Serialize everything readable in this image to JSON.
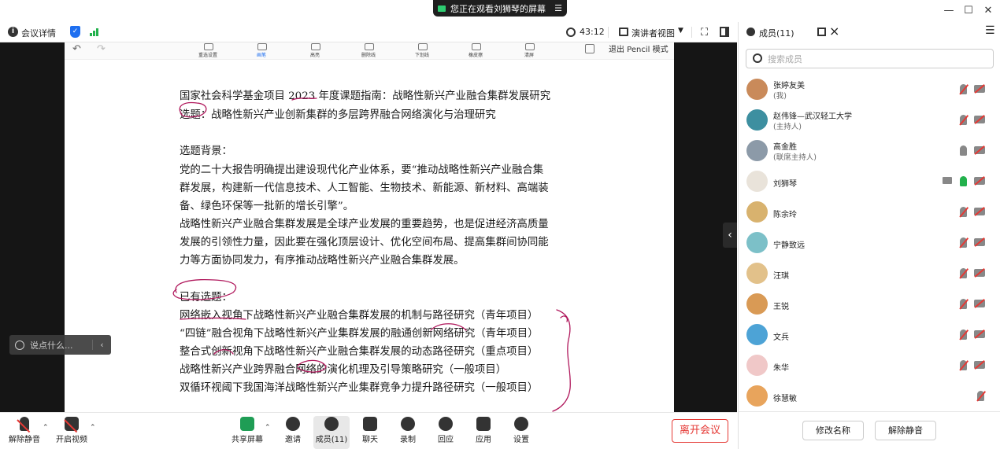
{
  "window": {
    "share_notice": "您正在观看刘狮琴的屏幕",
    "notice_menu": "☰",
    "min": "—",
    "max": "☐",
    "close": "✕"
  },
  "meetbar": {
    "info_label": "会议详情",
    "timer": "43:12",
    "view_label": "演讲者视图"
  },
  "pencil": {
    "tools": [
      "重选设置",
      "画笔",
      "高亮",
      "删除线",
      "下划线",
      "橡皮擦",
      "清屏"
    ],
    "active_tool": "画笔",
    "exit_label": "退出 Pencil 模式"
  },
  "document": {
    "lines": [
      "国家社会科学基金项目 2023 年度课题指南：战略性新兴产业融合集群发展研究",
      "选题：战略性新兴产业创新集群的多层跨界融合网络演化与治理研究",
      "",
      "选题背景：",
      "党的二十大报告明确提出建设现代化产业体系，要“推动战略性新兴产业融合集",
      "群发展，构建新一代信息技术、人工智能、生物技术、新能源、新材料、高端装",
      "备、绿色环保等一批新的增长引擎”。",
      "战略性新兴产业融合集群发展是全球产业发展的重要趋势，也是促进经济高质量",
      "发展的引领性力量，因此要在强化顶层设计、优化空间布局、提高集群间协同能",
      "力等方面协同发力，有序推动战略性新兴产业融合集群发展。",
      "",
      "已有选题：",
      "网络嵌入视角下战略性新兴产业融合集群发展的机制与路径研究（青年项目）",
      "“四链”融合视角下战略性新兴产业集群发展的融通创新网络研究（青年项目）",
      "整合式创新视角下战略性新兴产业融合集群发展的动态路径研究（重点项目）",
      "战略性新兴产业跨界融合网络的演化机理及引导策略研究（一般项目）",
      "双循环视阈下我国海洋战略性新兴产业集群竞争力提升路径研究（一般项目）"
    ]
  },
  "chat": {
    "placeholder": "说点什么..."
  },
  "controls": {
    "unmute": "解除静音",
    "start_video": "开启视频",
    "share_screen": "共享屏幕",
    "invite": "邀请",
    "members": "成员(11)",
    "chat": "聊天",
    "record": "录制",
    "reactions": "回应",
    "apps": "应用",
    "settings": "设置",
    "leave": "离开会议"
  },
  "panel": {
    "title": "成员(11)",
    "search_placeholder": "搜索成员",
    "members": [
      {
        "name": "张婷友美",
        "role": "(我)",
        "avatar": "#c98a5a"
      },
      {
        "name": "赵伟锋—武汉轻工大学",
        "role": "(主持人)",
        "avatar": "#3d8fa0"
      },
      {
        "name": "高金胜",
        "role": "(联席主持人)",
        "avatar": "#8c9aa8"
      },
      {
        "name": "刘狮琴",
        "role": "",
        "avatar": "#e9e3da"
      },
      {
        "name": "陈余玲",
        "role": "",
        "avatar": "#d8b26e"
      },
      {
        "name": "宁静致远",
        "role": "",
        "avatar": "#7cc0c8"
      },
      {
        "name": "汪琪",
        "role": "",
        "avatar": "#e2c18a"
      },
      {
        "name": "王锐",
        "role": "",
        "avatar": "#d99a55"
      },
      {
        "name": "文兵",
        "role": "",
        "avatar": "#4da3d6"
      },
      {
        "name": "朱华",
        "role": "",
        "avatar": "#f0c8c8"
      },
      {
        "name": "徐慧敏",
        "role": "",
        "avatar": "#e8a45c"
      }
    ],
    "rename": "修改名称",
    "unmute": "解除静音"
  },
  "colors": {
    "accent": "#1e6ff0",
    "danger": "#e53935",
    "active_green": "#22b14c",
    "ink": "#b0185c"
  }
}
